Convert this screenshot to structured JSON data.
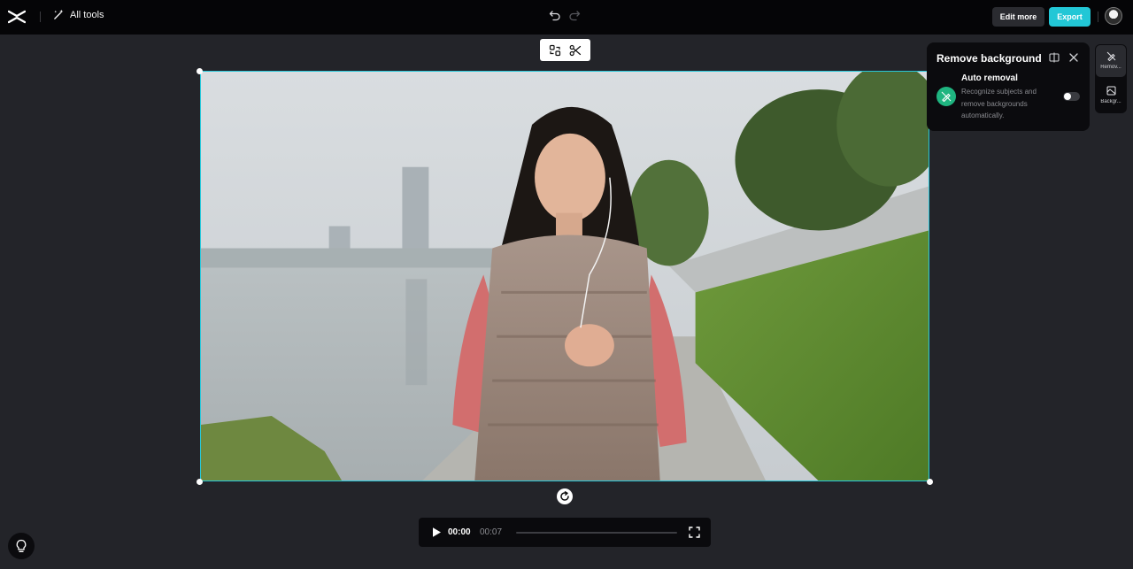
{
  "topbar": {
    "all_tools_label": "All tools",
    "edit_more_label": "Edit more",
    "export_label": "Export"
  },
  "icons": {
    "logo": "capcut-logo-icon",
    "magic": "magic-wand-icon",
    "undo": "undo-icon",
    "redo": "redo-icon",
    "swap": "swap-icon",
    "scissors": "scissors-icon",
    "rotate": "rotate-icon",
    "play": "play-icon",
    "fullscreen": "fullscreen-icon",
    "help": "lightbulb-icon"
  },
  "player": {
    "current_time": "00:00",
    "total_time": "00:07",
    "progress": 0
  },
  "panel": {
    "title": "Remove background",
    "auto_title": "Auto removal",
    "auto_description": "Recognize subjects and remove backgrounds automatically.",
    "auto_enabled": false
  },
  "rail": {
    "items": [
      {
        "label": "Remove background",
        "short": "Remov...",
        "active": true
      },
      {
        "label": "Background",
        "short": "Backgr...",
        "active": false
      }
    ]
  },
  "colors": {
    "accent": "#22c7d6",
    "topbar_bg": "#050507",
    "workspace_bg": "#232429",
    "panel_bg": "#0b0b0e",
    "auto_icon_bg": "#1fb580",
    "selection_border": "#27c7d9"
  }
}
